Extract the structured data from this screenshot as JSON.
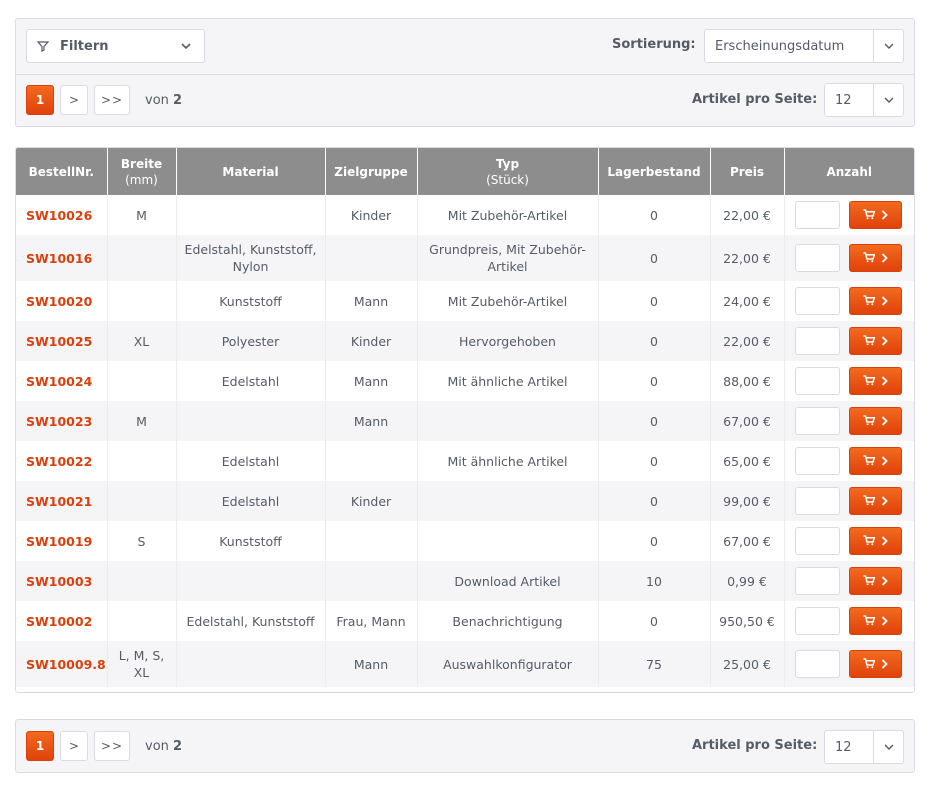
{
  "toolbar": {
    "filter_label": "Filtern",
    "sort_label": "Sortierung:",
    "sort_value": "Erscheinungsdatum",
    "per_page_label": "Artikel pro Seite:",
    "per_page_value": "12"
  },
  "pagination": {
    "current_page": "1",
    "next_label": ">",
    "last_label": ">>",
    "of_prefix": "von",
    "total_pages": "2"
  },
  "table": {
    "headers": {
      "ordernr": "BestellNr.",
      "breite": "Breite",
      "breite_unit": "(mm)",
      "material": "Material",
      "zielgruppe": "Zielgruppe",
      "typ": "Typ",
      "typ_unit": "(Stück)",
      "lagerbestand": "Lagerbestand",
      "preis": "Preis",
      "anzahl": "Anzahl"
    },
    "rows": [
      {
        "ordernr": "SW10026",
        "breite": "M",
        "material": "",
        "zielgruppe": "Kinder",
        "typ": "Mit Zubehör-Artikel",
        "lager": "0",
        "preis": "22,00 €"
      },
      {
        "ordernr": "SW10016",
        "breite": "",
        "material": "Edelstahl, Kunststoff, Nylon",
        "zielgruppe": "",
        "typ": "Grundpreis, Mit Zubehör-Artikel",
        "lager": "0",
        "preis": "22,00 €"
      },
      {
        "ordernr": "SW10020",
        "breite": "",
        "material": "Kunststoff",
        "zielgruppe": "Mann",
        "typ": "Mit Zubehör-Artikel",
        "lager": "0",
        "preis": "24,00 €"
      },
      {
        "ordernr": "SW10025",
        "breite": "XL",
        "material": "Polyester",
        "zielgruppe": "Kinder",
        "typ": "Hervorgehoben",
        "lager": "0",
        "preis": "22,00 €"
      },
      {
        "ordernr": "SW10024",
        "breite": "",
        "material": "Edelstahl",
        "zielgruppe": "Mann",
        "typ": "Mit ähnliche Artikel",
        "lager": "0",
        "preis": "88,00 €"
      },
      {
        "ordernr": "SW10023",
        "breite": "M",
        "material": "",
        "zielgruppe": "Mann",
        "typ": "",
        "lager": "0",
        "preis": "67,00 €"
      },
      {
        "ordernr": "SW10022",
        "breite": "",
        "material": "Edelstahl",
        "zielgruppe": "",
        "typ": "Mit ähnliche Artikel",
        "lager": "0",
        "preis": "65,00 €"
      },
      {
        "ordernr": "SW10021",
        "breite": "",
        "material": "Edelstahl",
        "zielgruppe": "Kinder",
        "typ": "",
        "lager": "0",
        "preis": "99,00 €"
      },
      {
        "ordernr": "SW10019",
        "breite": "S",
        "material": "Kunststoff",
        "zielgruppe": "",
        "typ": "",
        "lager": "0",
        "preis": "67,00 €"
      },
      {
        "ordernr": "SW10003",
        "breite": "",
        "material": "",
        "zielgruppe": "",
        "typ": "Download Artikel",
        "lager": "10",
        "preis": "0,99 €"
      },
      {
        "ordernr": "SW10002",
        "breite": "",
        "material": "Edelstahl, Kunststoff",
        "zielgruppe": "Frau, Mann",
        "typ": "Benachrichtigung",
        "lager": "0",
        "preis": "950,50 €"
      },
      {
        "ordernr": "SW10009.8",
        "breite": "L, M, S, XL",
        "material": "",
        "zielgruppe": "Mann",
        "typ": "Auswahlkonfigurator",
        "lager": "75",
        "preis": "25,00 €"
      }
    ]
  },
  "colors": {
    "accent": "#e0420b",
    "header_bg": "#8d8d8d",
    "panel_bg": "#f5f5f8"
  }
}
